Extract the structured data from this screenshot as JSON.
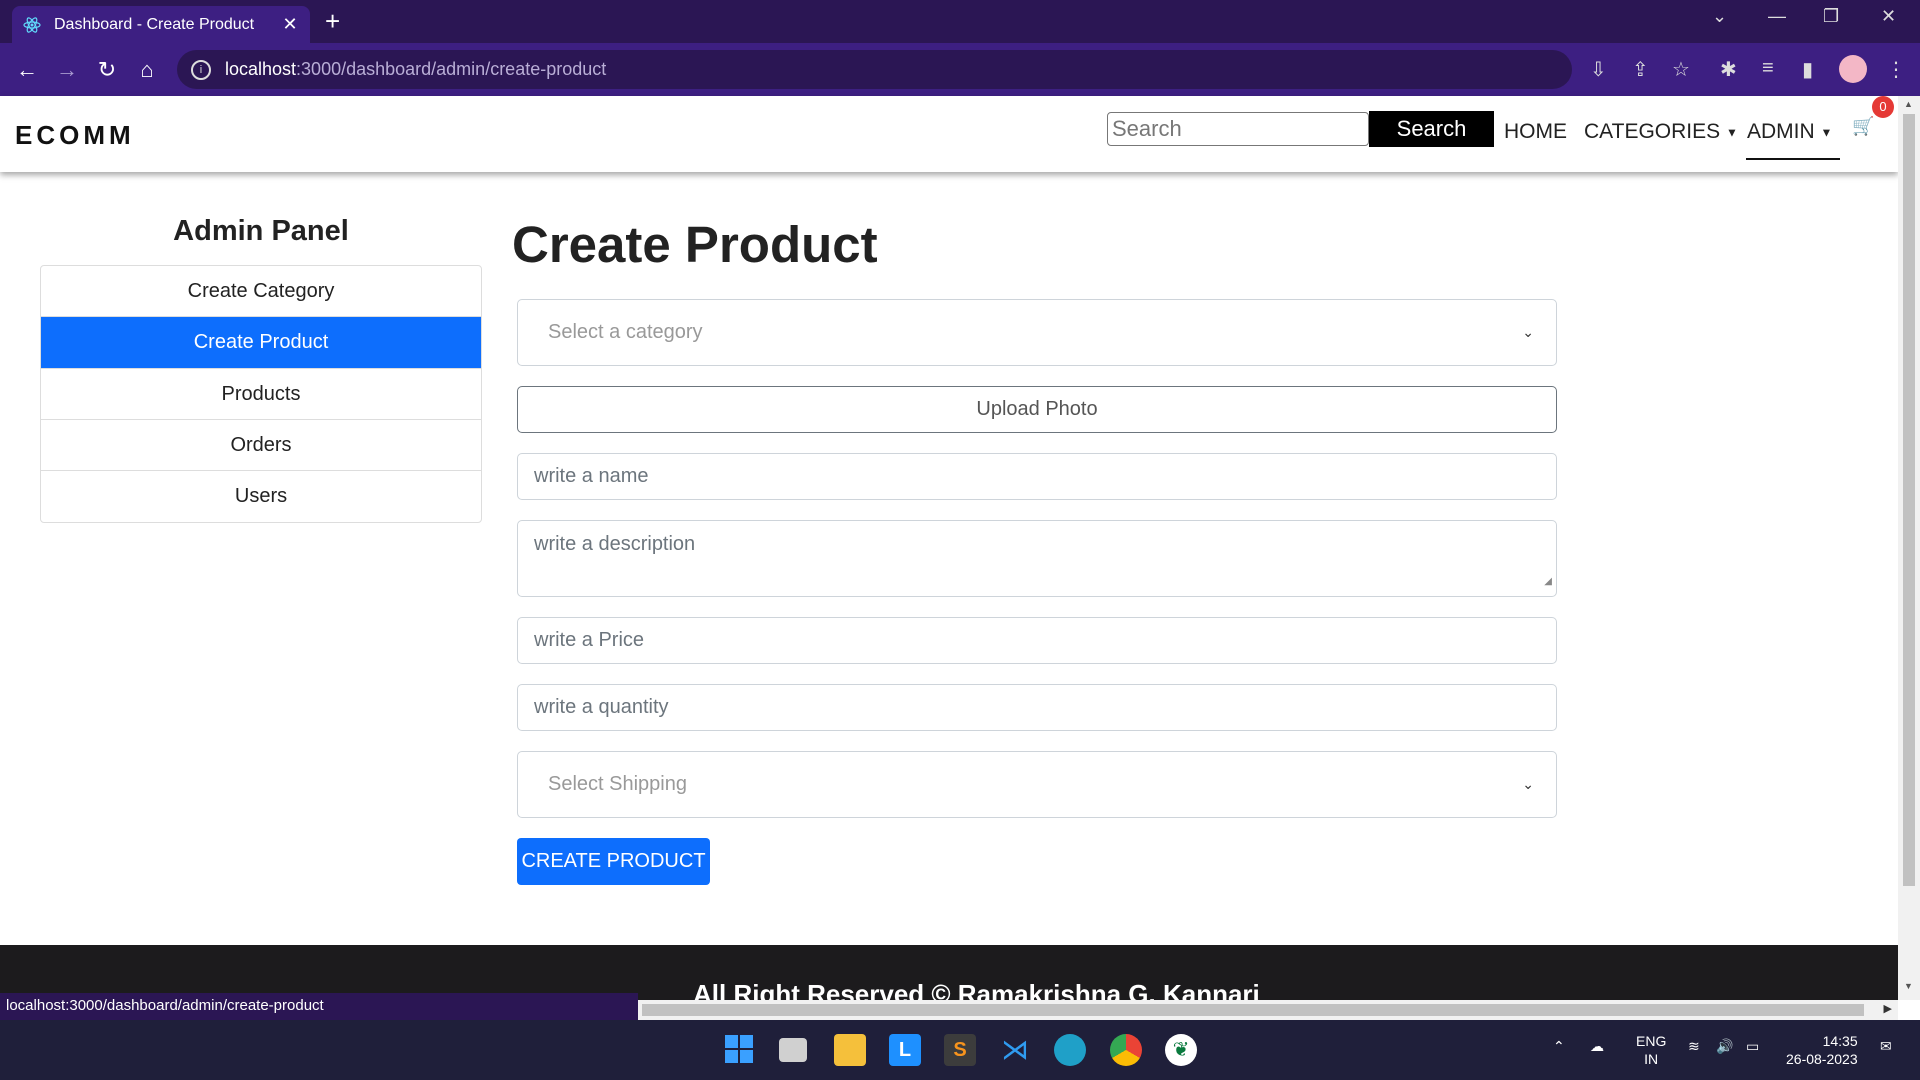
{
  "browser": {
    "tab_title": "Dashboard - Create Product",
    "url_host": "localhost",
    "url_path": ":3000/dashboard/admin/create-product",
    "status_url": "localhost:3000/dashboard/admin/create-product"
  },
  "navbar": {
    "brand": "ECOMM",
    "search_placeholder": "Search",
    "search_button": "Search",
    "links": {
      "home": "HOME",
      "categories": "CATEGORIES",
      "admin": "ADMIN"
    },
    "cart_count": "0"
  },
  "sidebar": {
    "title": "Admin Panel",
    "items": [
      {
        "label": "Create Category",
        "active": false
      },
      {
        "label": "Create Product",
        "active": true
      },
      {
        "label": "Products",
        "active": false
      },
      {
        "label": "Orders",
        "active": false
      },
      {
        "label": "Users",
        "active": false
      }
    ]
  },
  "form": {
    "title": "Create Product",
    "category_placeholder": "Select a category",
    "upload_label": "Upload Photo",
    "name_placeholder": "write a name",
    "description_placeholder": "write a description",
    "price_placeholder": "write a Price",
    "quantity_placeholder": "write a quantity",
    "shipping_placeholder": "Select Shipping",
    "submit_label": "CREATE PRODUCT"
  },
  "footer": {
    "text": "All Right Reserved © Ramakrishna G. Kannari"
  },
  "taskbar": {
    "lang_top": "ENG",
    "lang_bottom": "IN",
    "time": "14:35",
    "date": "26-08-2023"
  },
  "colors": {
    "primary": "#0d6efd",
    "browser_frame": "#3d1f82",
    "footer": "#1c1b1d",
    "badge": "#e53935"
  }
}
